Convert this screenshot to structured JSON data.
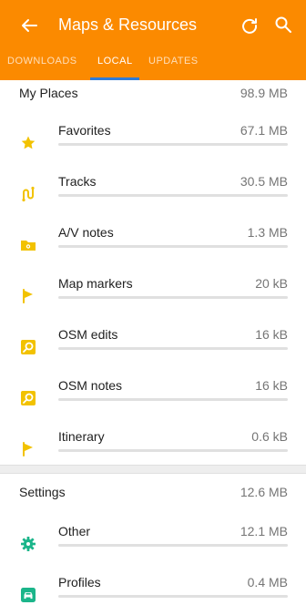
{
  "app": {
    "title": "Maps & Resources"
  },
  "tabs": [
    {
      "label": "DOWNLOADS"
    },
    {
      "label": "LOCAL"
    },
    {
      "label": "UPDATES"
    }
  ],
  "sections": [
    {
      "name": "My Places",
      "size": "98.9 MB",
      "items": [
        {
          "label": "Favorites",
          "size": "67.1 MB",
          "icon": "star-icon",
          "color": "#f2c200"
        },
        {
          "label": "Tracks",
          "size": "30.5 MB",
          "icon": "track-icon",
          "color": "#f2c200"
        },
        {
          "label": "A/V notes",
          "size": "1.3 MB",
          "icon": "av-notes-folder-icon",
          "color": "#f2c200"
        },
        {
          "label": "Map markers",
          "size": "20 kB",
          "icon": "flag-icon",
          "color": "#f2c200"
        },
        {
          "label": "OSM edits",
          "size": "16 kB",
          "icon": "osm-edit-icon",
          "color": "#f2c200"
        },
        {
          "label": "OSM notes",
          "size": "16 kB",
          "icon": "osm-note-icon",
          "color": "#f2c200"
        },
        {
          "label": "Itinerary",
          "size": "0.6 kB",
          "icon": "flag-icon",
          "color": "#f2c200"
        }
      ]
    },
    {
      "name": "Settings",
      "size": "12.6 MB",
      "items": [
        {
          "label": "Other",
          "size": "12.1 MB",
          "icon": "gear-icon",
          "color": "#1bb58a"
        },
        {
          "label": "Profiles",
          "size": "0.4 MB",
          "icon": "profile-car-icon",
          "color": "#1bb58a"
        }
      ]
    }
  ],
  "colors": {
    "appbar": "#fb8a00",
    "tab_indicator": "#2e7bd8"
  }
}
